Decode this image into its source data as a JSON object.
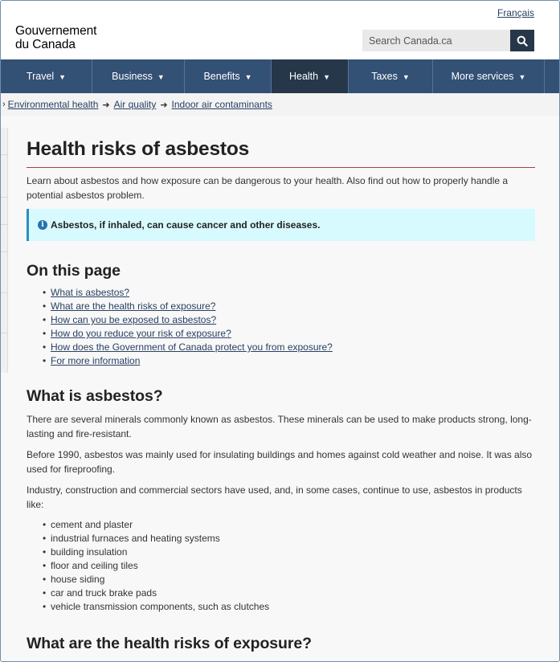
{
  "header": {
    "language_link": "Français",
    "brand_line1": "Gouvernement",
    "brand_line2": "du Canada",
    "search_placeholder": "Search Canada.ca",
    "search_icon": "magnifier-icon"
  },
  "nav": {
    "items": [
      {
        "label": "Travel",
        "active": false
      },
      {
        "label": "Business",
        "active": false
      },
      {
        "label": "Benefits",
        "active": false
      },
      {
        "label": "Health",
        "active": true
      },
      {
        "label": "Taxes",
        "active": false
      },
      {
        "label": "More services",
        "active": false
      }
    ]
  },
  "breadcrumb": {
    "items": [
      "Environmental health",
      "Air quality",
      "Indoor air contaminants"
    ]
  },
  "page": {
    "title": "Health risks of asbestos",
    "lead": "Learn about asbestos and how exposure can be dangerous to your health. Also find out how to properly handle a potential asbestos problem.",
    "alert": "Asbestos, if inhaled, can cause cancer and other diseases.",
    "toc_heading": "On this page",
    "toc": [
      "What is asbestos?",
      "What are the health risks of exposure?",
      "How can you be exposed to asbestos?",
      "How do you reduce your risk of exposure?",
      "How does the Government of Canada protect you from exposure?",
      "For more information"
    ],
    "section1_heading": "What is asbestos?",
    "section1_p1": "There are several minerals commonly known as asbestos. These minerals can be used to make products strong, long-lasting and fire-resistant.",
    "section1_p2": "Before 1990, asbestos was mainly used for insulating buildings and homes against cold weather and noise. It was also used for fireproofing.",
    "section1_p3": "Industry, construction and commercial sectors have used, and, in some cases, continue to use, asbestos in products like:",
    "products": [
      "cement and plaster",
      "industrial furnaces and heating systems",
      "building insulation",
      "floor and ceiling tiles",
      "house siding",
      "car and truck brake pads",
      "vehicle transmission components, such as clutches"
    ],
    "section2_heading": "What are the health risks of exposure?"
  },
  "colors": {
    "nav_bg": "#335075",
    "nav_active": "#26374a",
    "title_rule": "#af3c43",
    "alert_bg": "#d7faff",
    "alert_border": "#2b8cc4",
    "link": "#284162"
  }
}
